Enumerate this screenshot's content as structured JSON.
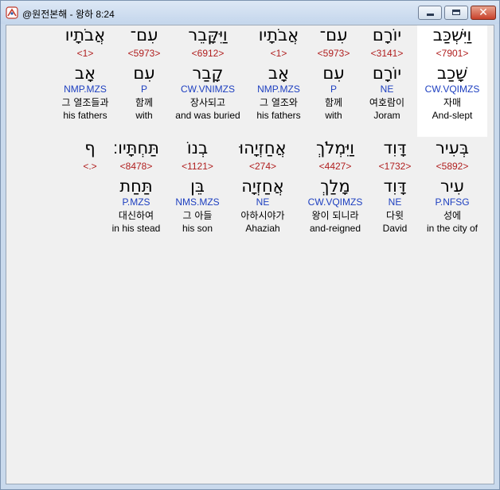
{
  "window": {
    "title": "@원전본해 - 왕하 8:24",
    "buttons": {
      "close": "✕"
    }
  },
  "lines": [
    {
      "words": [
        {
          "hebrew": "וַיִּשְׁכַּב",
          "strong": "<7901>",
          "lemma": "שָׁכַב",
          "morph": "CW.VQIMZS",
          "korean": "자매",
          "english": "And-slept",
          "highlight": true
        },
        {
          "hebrew": "יוֹרָם",
          "strong": "<3141>",
          "lemma": "יוֹרָם",
          "morph": "NE",
          "korean": "여호람이",
          "english": "Joram"
        },
        {
          "hebrew": "עִם־",
          "strong": "<5973>",
          "lemma": "עִם",
          "morph": "P",
          "korean": "함께",
          "english": "with"
        },
        {
          "hebrew": "אֲבֹתָיו",
          "strong": "<1>",
          "lemma": "אָב",
          "morph": "NMP.MZS",
          "korean": "그 열조와",
          "english": "his fathers"
        },
        {
          "hebrew": "וַיִּקָּבֵר",
          "strong": "<6912>",
          "lemma": "קָבַר",
          "morph": "CW.VNIMZS",
          "korean": "장사되고",
          "english": "and was buried"
        },
        {
          "hebrew": "עִם־",
          "strong": "<5973>",
          "lemma": "עִם",
          "morph": "P",
          "korean": "함께",
          "english": "with"
        },
        {
          "hebrew": "אֲבֹתָיו",
          "strong": "<1>",
          "lemma": "אָב",
          "morph": "NMP.MZS",
          "korean": "그 열조들과",
          "english": "his fathers"
        }
      ]
    },
    {
      "words": [
        {
          "hebrew": "בְּעִיר",
          "strong": "<5892>",
          "lemma": "עִיר",
          "morph": "P.NFSG",
          "korean": "성에",
          "english": "in the city of"
        },
        {
          "hebrew": "דָּוִד",
          "strong": "<1732>",
          "lemma": "דָּוִד",
          "morph": "NE",
          "korean": "다윗",
          "english": "David"
        },
        {
          "hebrew": "וַיִּמְלֹךְ",
          "strong": "<4427>",
          "lemma": "מָלַךְ",
          "morph": "CW.VQIMZS",
          "korean": "왕이 되니라",
          "english": "and-reigned"
        },
        {
          "hebrew": "אֲחַזְיָהוּ",
          "strong": "<274>",
          "lemma": "אֲחַזְיָה",
          "morph": "NE",
          "korean": "아하시야가",
          "english": "Ahaziah"
        },
        {
          "hebrew": "בְנוֹ",
          "strong": "<1121>",
          "lemma": "בֵּן",
          "morph": "NMS.MZS",
          "korean": "그 아들",
          "english": "his son"
        },
        {
          "hebrew": "תַּחְתָּיו׃",
          "strong": "<8478>",
          "lemma": "תַּחַת",
          "morph": "P.MZS",
          "korean": "대신하여",
          "english": "in his stead"
        },
        {
          "hebrew": "ף",
          "strong": "<.>",
          "lemma": "",
          "morph": "",
          "korean": "",
          "english": ""
        }
      ]
    }
  ]
}
